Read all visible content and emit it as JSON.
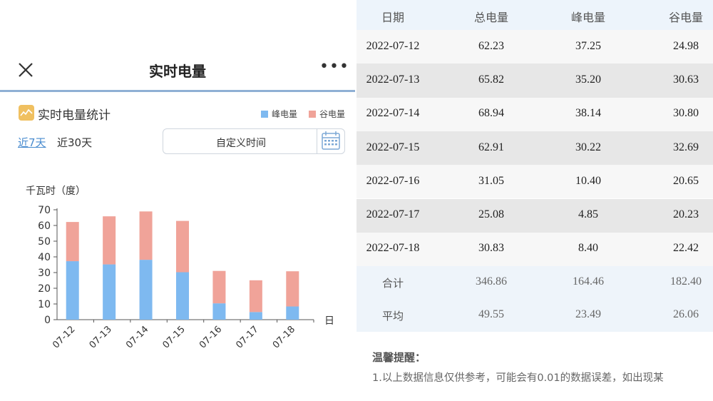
{
  "app": {
    "title": "实时电量",
    "more_label": "•••"
  },
  "stats": {
    "title": "实时电量统计",
    "legend": [
      {
        "name": "峰电量",
        "color": "#7eb9f0"
      },
      {
        "name": "谷电量",
        "color": "#f0a399"
      }
    ],
    "tabs": [
      {
        "label": "近7天",
        "active": true
      },
      {
        "label": "近30天",
        "active": false
      }
    ],
    "custom_time_label": "自定义时间"
  },
  "chart_data": {
    "type": "bar",
    "stacked": true,
    "ylabel": "千瓦时（度）",
    "xlabel": "日",
    "categories": [
      "07-12",
      "07-13",
      "07-14",
      "07-15",
      "07-16",
      "07-17",
      "07-18"
    ],
    "ylim": [
      0,
      70
    ],
    "yticks": [
      0,
      10,
      20,
      30,
      40,
      50,
      60,
      70
    ],
    "series": [
      {
        "name": "峰电量",
        "color": "#7eb9f0",
        "values": [
          37.25,
          35.2,
          38.14,
          30.22,
          10.4,
          4.85,
          8.4
        ]
      },
      {
        "name": "谷电量",
        "color": "#f0a399",
        "values": [
          24.98,
          30.63,
          30.8,
          32.69,
          20.65,
          20.23,
          22.42
        ]
      }
    ],
    "grid": false
  },
  "table": {
    "headers": [
      "日期",
      "总电量",
      "峰电量",
      "谷电量"
    ],
    "rows": [
      [
        "2022-07-12",
        "62.23",
        "37.25",
        "24.98"
      ],
      [
        "2022-07-13",
        "65.82",
        "35.20",
        "30.63"
      ],
      [
        "2022-07-14",
        "68.94",
        "38.14",
        "30.80"
      ],
      [
        "2022-07-15",
        "62.91",
        "30.22",
        "32.69"
      ],
      [
        "2022-07-16",
        "31.05",
        "10.40",
        "20.65"
      ],
      [
        "2022-07-17",
        "25.08",
        "4.85",
        "20.23"
      ],
      [
        "2022-07-18",
        "30.83",
        "8.40",
        "22.42"
      ]
    ],
    "summary": [
      [
        "合计",
        "346.86",
        "164.46",
        "182.40"
      ],
      [
        "平均",
        "49.55",
        "23.49",
        "26.06"
      ]
    ]
  },
  "tips": {
    "title": "温馨提醒：",
    "text": "1.以上数据信息仅供参考，可能会有0.01的数据误差，如出现某"
  }
}
